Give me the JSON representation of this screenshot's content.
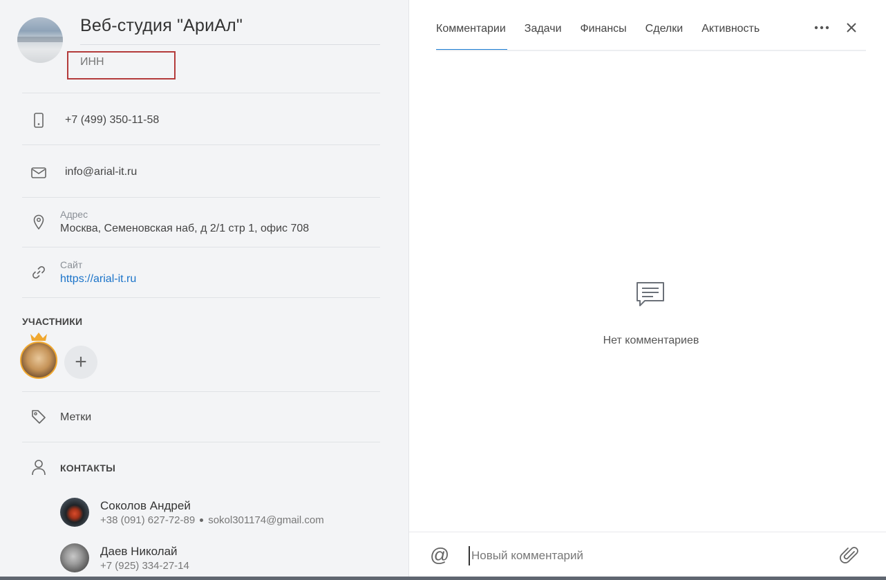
{
  "company": {
    "name": "Веб-студия \"АриАл\"",
    "inn_label": "ИНН"
  },
  "contact_info": {
    "phone": "+7 (499) 350-11-58",
    "email": "info@arial-it.ru",
    "address_caption": "Адрес",
    "address": "Москва, Семеновская наб, д 2/1 стр 1, офис 708",
    "site_caption": "Сайт",
    "site": "https://arial-it.ru"
  },
  "participants": {
    "title": "УЧАСТНИКИ",
    "add_label": "+"
  },
  "tags": {
    "label": "Метки"
  },
  "contacts": {
    "title": "КОНТАКТЫ",
    "items": [
      {
        "name": "Соколов Андрей",
        "phone": "+38 (091) 627-72-89",
        "email": "sokol301174@gmail.com"
      },
      {
        "name": "Даев Николай",
        "phone": "+7 (925) 334-27-14"
      }
    ]
  },
  "tabs": [
    {
      "label": "Комментарии",
      "active": true
    },
    {
      "label": "Задачи"
    },
    {
      "label": "Финансы"
    },
    {
      "label": "Сделки"
    },
    {
      "label": "Активность"
    }
  ],
  "empty_state": {
    "icon": "comment-icon",
    "text": "Нет комментариев"
  },
  "composer": {
    "at_symbol": "@",
    "placeholder": "Новый комментарий",
    "attach_icon": "paperclip-icon"
  },
  "colors": {
    "accent": "#1a7bd3",
    "link": "#1a73c9",
    "highlight_border": "#b33a3a",
    "crown": "#f0a830"
  }
}
